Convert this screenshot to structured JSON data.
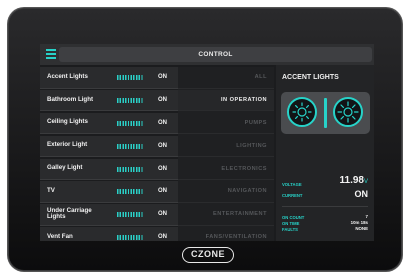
{
  "header": {
    "title": "CONTROL"
  },
  "loads": [
    {
      "name": "Accent Lights",
      "state": "ON"
    },
    {
      "name": "Bathroom Light",
      "state": "ON"
    },
    {
      "name": "Ceiling Lights",
      "state": "ON"
    },
    {
      "name": "Exterior Light",
      "state": "ON"
    },
    {
      "name": "Galley Light",
      "state": "ON"
    },
    {
      "name": "TV",
      "state": "ON"
    },
    {
      "name": "Under Carriage Lights",
      "state": "ON"
    },
    {
      "name": "Vent Fan",
      "state": "ON"
    }
  ],
  "categories": [
    {
      "label": "ALL",
      "active": false
    },
    {
      "label": "IN OPERATION",
      "active": true
    },
    {
      "label": "PUMPS",
      "active": false
    },
    {
      "label": "LIGHTING",
      "active": false
    },
    {
      "label": "ELECTRONICS",
      "active": false
    },
    {
      "label": "NAVIGATION",
      "active": false
    },
    {
      "label": "ENTERTAINMENT",
      "active": false
    },
    {
      "label": "FANS/VENTILATION",
      "active": false
    }
  ],
  "detail": {
    "title": "ACCENT LIGHTS",
    "voltage_label": "VOLTAGE",
    "voltage_value": "11.98",
    "voltage_unit": "V",
    "current_label": "CURRENT",
    "current_value": "ON",
    "on_count_label": "ON COUNT",
    "on_count_value": "7",
    "on_time_label": "ON TIME",
    "on_time_value": "10m 18s",
    "faults_label": "FAULTS",
    "faults_value": "NONE"
  },
  "brand": {
    "logo_text": "CZONE"
  },
  "colors": {
    "accent": "#27d3c9",
    "panel": "#2a2b2d",
    "background": "#1b1c1e"
  },
  "icons": {
    "menu": "hamburger-menu-icon",
    "dimmer": "dimmer-sun-icon"
  }
}
